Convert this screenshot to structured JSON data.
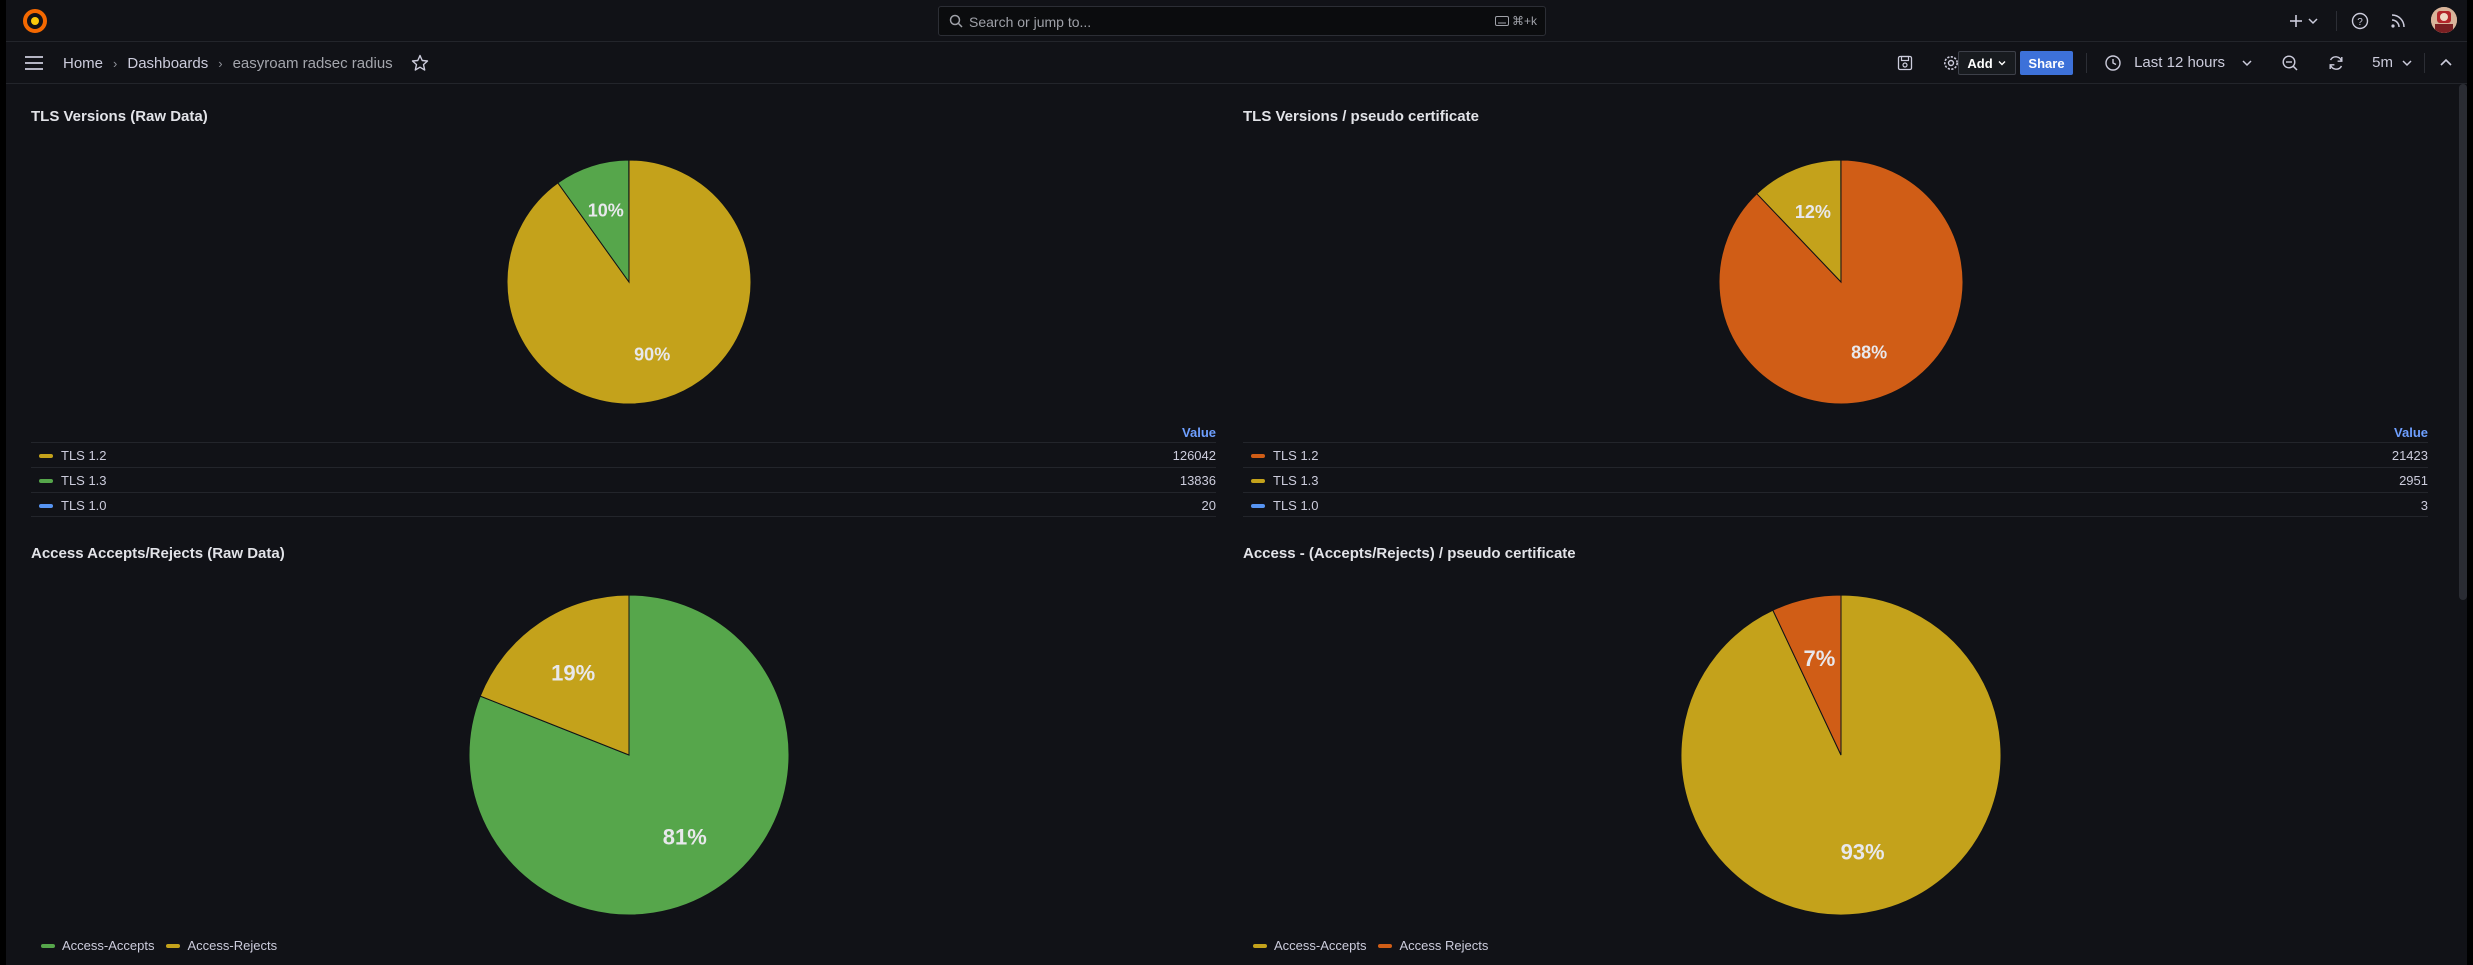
{
  "search": {
    "placeholder": "Search or jump to...",
    "shortcut": "⌘+k"
  },
  "breadcrumb": [
    {
      "label": "Home"
    },
    {
      "label": "Dashboards"
    },
    {
      "label": "easyroam radsec radius"
    }
  ],
  "toolbar": {
    "add_label": "Add",
    "share_label": "Share",
    "time_range": "Last 12 hours",
    "refresh_interval": "5m"
  },
  "colors": {
    "green": "#56a64b",
    "yellow": "#c4a21b",
    "orange": "#d05d16",
    "blue": "#5794f2",
    "share_blue": "#3d71d9"
  },
  "panels": [
    {
      "title": "TLS Versions (Raw Data)",
      "legend_header": "Value",
      "legend": [
        {
          "name": "TLS 1.2",
          "value": "126042",
          "color": "#c4a21b"
        },
        {
          "name": "TLS 1.3",
          "value": "13836",
          "color": "#56a64b"
        },
        {
          "name": "TLS 1.0",
          "value": "20",
          "color": "#5794f2"
        }
      ]
    },
    {
      "title": "TLS Versions / pseudo certificate",
      "legend_header": "Value",
      "legend": [
        {
          "name": "TLS 1.2",
          "value": "21423",
          "color": "#d05d16"
        },
        {
          "name": "TLS 1.3",
          "value": "2951",
          "color": "#c4a21b"
        },
        {
          "name": "TLS 1.0",
          "value": "3",
          "color": "#5794f2"
        }
      ]
    },
    {
      "title": "Access Accepts/Rejects (Raw Data)",
      "legend": [
        {
          "name": "Access-Accepts",
          "color": "#56a64b"
        },
        {
          "name": "Access-Rejects",
          "color": "#c4a21b"
        }
      ]
    },
    {
      "title": "Access - (Accepts/Rejects) / pseudo certificate",
      "legend": [
        {
          "name": "Access-Accepts",
          "color": "#c4a21b"
        },
        {
          "name": "Access Rejects",
          "color": "#d05d16"
        }
      ]
    }
  ],
  "chart_data": [
    {
      "type": "pie",
      "title": "TLS Versions (Raw Data)",
      "labels": [
        "TLS 1.2",
        "TLS 1.3",
        "TLS 1.0"
      ],
      "values": [
        126042,
        13836,
        20
      ],
      "colors": [
        "#c4a21b",
        "#56a64b",
        "#5794f2"
      ],
      "slice_labels": [
        "90%",
        "10%",
        ""
      ],
      "legend": "bottom table"
    },
    {
      "type": "pie",
      "title": "TLS Versions / pseudo certificate",
      "labels": [
        "TLS 1.2",
        "TLS 1.3",
        "TLS 1.0"
      ],
      "values": [
        21423,
        2951,
        3
      ],
      "colors": [
        "#d05d16",
        "#c4a21b",
        "#5794f2"
      ],
      "slice_labels": [
        "88%",
        "12%",
        ""
      ],
      "legend": "bottom table"
    },
    {
      "type": "pie",
      "title": "Access Accepts/Rejects (Raw Data)",
      "labels": [
        "Access-Accepts",
        "Access-Rejects"
      ],
      "values": [
        81,
        19
      ],
      "colors": [
        "#56a64b",
        "#c4a21b"
      ],
      "slice_labels": [
        "81%",
        "19%"
      ],
      "legend": "bottom list"
    },
    {
      "type": "pie",
      "title": "Access - (Accepts/Rejects) / pseudo certificate",
      "labels": [
        "Access-Accepts",
        "Access Rejects"
      ],
      "values": [
        93,
        7
      ],
      "colors": [
        "#c4a21b",
        "#d05d16"
      ],
      "slice_labels": [
        "93%",
        "7%"
      ],
      "legend": "bottom list"
    }
  ]
}
